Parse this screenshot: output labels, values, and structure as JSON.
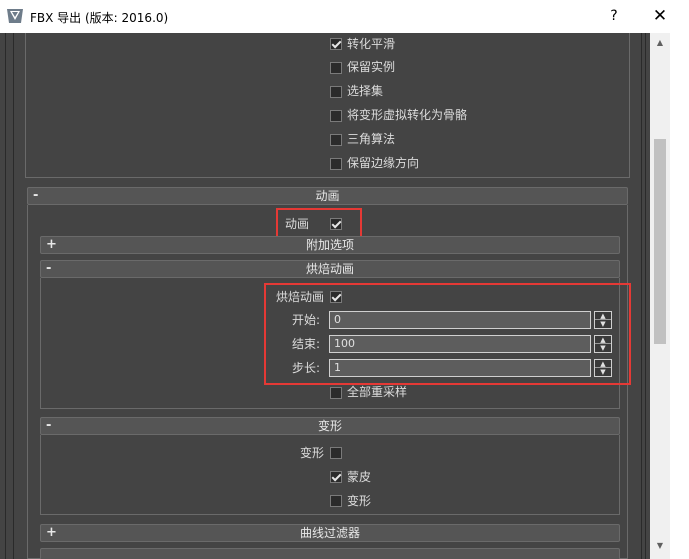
{
  "window": {
    "title": "FBX 导出 (版本: 2016.0)",
    "help_glyph": "?",
    "close_glyph": "✕",
    "icon": "3ds-max-icon"
  },
  "geometry_options": [
    {
      "label": "转化平滑",
      "checked": true
    },
    {
      "label": "保留实例",
      "checked": false
    },
    {
      "label": "选择集",
      "checked": false
    },
    {
      "label": "将变形虚拟转化为骨骼",
      "checked": false
    },
    {
      "label": "三角算法",
      "checked": false
    },
    {
      "label": "保留边缘方向",
      "checked": false
    }
  ],
  "animation": {
    "header": "动画",
    "collapse_sign": "-",
    "animation_checkbox": {
      "label": "动画",
      "checked": true
    },
    "extra_options": {
      "header": "附加选项",
      "sign": "+"
    },
    "bake": {
      "header": "烘焙动画",
      "sign": "-",
      "checkbox": {
        "label": "烘焙动画",
        "checked": true
      },
      "start": {
        "label": "开始:",
        "value": "0"
      },
      "end": {
        "label": "结束:",
        "value": "100"
      },
      "step": {
        "label": "步长:",
        "value": "1"
      },
      "resample_all": {
        "label": "全部重采样",
        "checked": false
      }
    },
    "deform": {
      "header": "变形",
      "sign": "-",
      "deform_checkbox": {
        "label": "变形",
        "checked": false
      },
      "skin": {
        "label": "蒙皮",
        "checked": true
      },
      "morph": {
        "label": "变形",
        "checked": false
      }
    },
    "curve_filter": {
      "header": "曲线过滤器",
      "sign": "+"
    }
  },
  "colors": {
    "highlight": "#e53935",
    "panel_bg": "#444444"
  }
}
